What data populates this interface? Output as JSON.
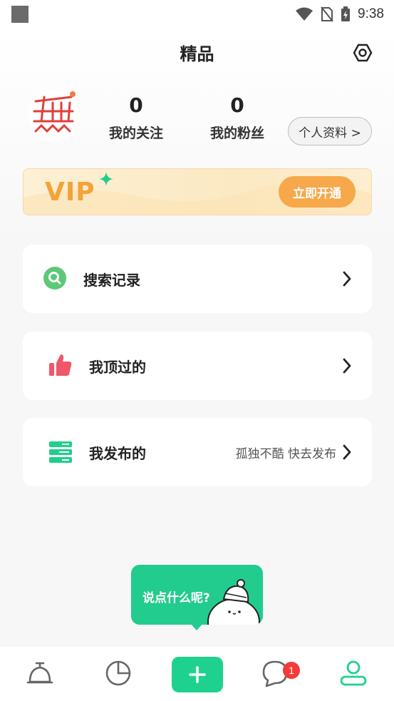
{
  "status_bar": {
    "time": "9:38"
  },
  "header": {
    "title": "精品"
  },
  "profile": {
    "following_count": "0",
    "following_label": "我的关注",
    "fans_count": "0",
    "fans_label": "我的粉丝",
    "profile_button": "个人资料 >"
  },
  "vip": {
    "label": "VIP",
    "button": "立即开通"
  },
  "menu": {
    "search_history": "搜索记录",
    "liked": "我顶过的",
    "published": "我发布的",
    "published_hint": "孤独不酷 快去发布"
  },
  "bubble": {
    "text": "说点什么呢?"
  },
  "bottom_nav": {
    "messages_badge": "1"
  },
  "colors": {
    "accent": "#1fd18f",
    "vip_orange": "#f3a338",
    "badge_red": "#f23b3b"
  }
}
